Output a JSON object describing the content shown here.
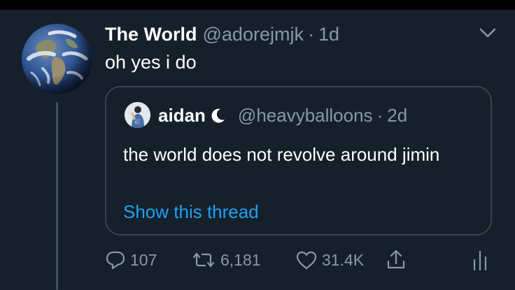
{
  "tweet": {
    "author_name": "The World",
    "handle": "@adorejmjk",
    "separator": "·",
    "time": "1d",
    "text": "oh yes i do",
    "avatar_icon": "earth-globe-icon",
    "menu_icon": "chevron-down-icon"
  },
  "quoted_tweet": {
    "author_name": "aidan",
    "badge_icon": "crescent-moon-icon",
    "handle": "@heavyballoons",
    "separator": "·",
    "time": "2d",
    "text": "the world does not revolve around jimin",
    "show_thread": "Show this thread"
  },
  "actions": {
    "replies": "107",
    "retweets": "6,181",
    "likes": "31.4K",
    "reply_icon": "reply-bubble-icon",
    "retweet_icon": "retweet-icon",
    "like_icon": "heart-icon",
    "share_icon": "share-icon",
    "analytics_icon": "analytics-bars-icon"
  },
  "colors": {
    "background": "#15202b",
    "text": "#ffffff",
    "muted": "#8899a6",
    "link": "#1da1f2",
    "border": "#38444d"
  }
}
